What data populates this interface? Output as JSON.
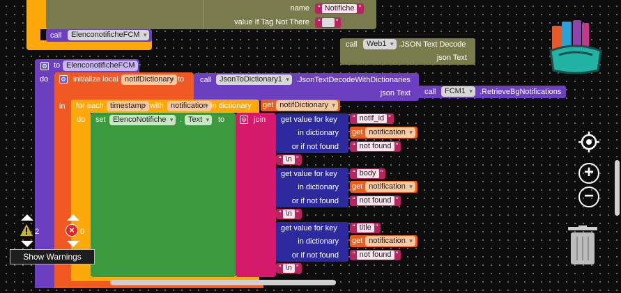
{
  "top": {
    "name_label": "name",
    "name_value": "Notifiche",
    "value_if_tag_label": "value If Tag Not There",
    "call_label": "call",
    "call_proc": "ElenconotificheFCM"
  },
  "web1_block": {
    "call": "call",
    "component": "Web1",
    "method": ".JSON Text Decode",
    "param": "json Text"
  },
  "proc": {
    "to": "to",
    "name": "ElenconotificheFCM",
    "do": "do"
  },
  "init_local": {
    "label": "initialize local",
    "var": "notifDictionary",
    "to": "to",
    "call": "call",
    "component": "JsonToDictionary1",
    "method": ".JsonTextDecodeWithDictionaries",
    "param": "json Text",
    "call2": "call",
    "component2": "FCM1",
    "method2": ".RetrieveBgNotifications",
    "in": "in"
  },
  "foreach": {
    "label": "for each",
    "var": "timestamp",
    "with": "with",
    "var2": "notification",
    "in_dict": "in dictionary",
    "get": "get",
    "get_var": "notifDictionary",
    "do": "do"
  },
  "set_block": {
    "set": "set",
    "component": "ElencoNotifiche",
    "dot": ".",
    "prop": "Text",
    "to": "to"
  },
  "join": {
    "label": "join",
    "gets": [
      {
        "label": "get value for key",
        "key": "notif_id",
        "in_dict": "in dictionary",
        "get": "get",
        "var": "notification",
        "or_if": "or if not found",
        "default": "not found"
      },
      {
        "label": "get value for key",
        "key": "body",
        "in_dict": "in dictionary",
        "get": "get",
        "var": "notification",
        "or_if": "or if not found",
        "default": "not found"
      },
      {
        "label": "get value for key",
        "key": "title",
        "in_dict": "in dictionary",
        "get": "get",
        "var": "notification",
        "or_if": "or if not found",
        "default": "not found"
      }
    ],
    "newline": "\\n"
  },
  "warnings": {
    "warn_count": "2",
    "error_count": "0",
    "button": "Show Warnings"
  },
  "colors": {
    "procedure": "#6b3fbf",
    "local": "#f05a22",
    "control": "#fda90b",
    "set": "#3a9a3d",
    "text": "#d51a6c",
    "dict": "#2d2aa0",
    "component": "#7a7b4c"
  }
}
